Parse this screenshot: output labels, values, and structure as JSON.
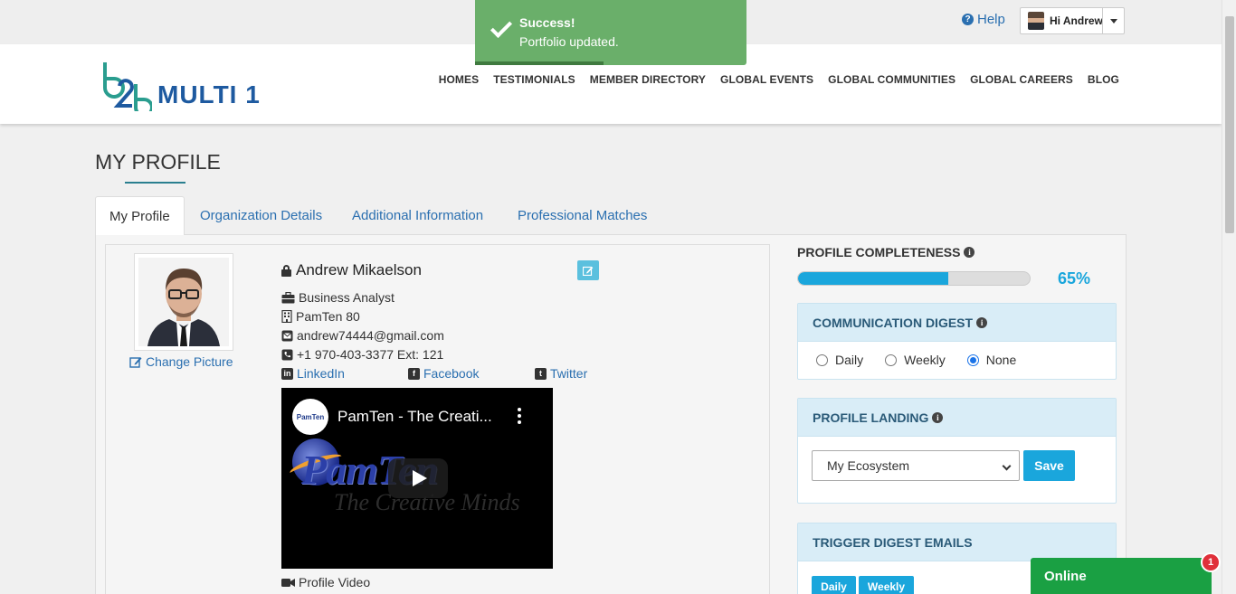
{
  "topbar": {
    "help_label": "Help",
    "user_greeting": "Hi Andrew"
  },
  "header": {
    "logo_mark": "b2b",
    "logo_text": "MULTI 1",
    "nav": [
      "HOMES",
      "TESTIMONIALS",
      "MEMBER DIRECTORY",
      "GLOBAL EVENTS",
      "GLOBAL COMMUNITIES",
      "GLOBAL CAREERS",
      "BLOG"
    ]
  },
  "toast": {
    "title": "Success!",
    "message": "Portfolio updated."
  },
  "page": {
    "title": "MY PROFILE",
    "tabs": [
      "My Profile",
      "Organization Details",
      "Additional Information",
      "Professional Matches"
    ],
    "active_tab": 0
  },
  "profile": {
    "change_picture": "Change Picture",
    "name": "Andrew Mikaelson",
    "title": "Business Analyst",
    "company": "PamTen 80",
    "email": "andrew74444@gmail.com",
    "phone": "+1 970-403-3377 Ext: 121",
    "linkedin": "LinkedIn",
    "facebook": "Facebook",
    "twitter": "Twitter",
    "video_title": "PamTen - The Creati...",
    "video_channel": "PamTen",
    "video_brand": "PamTen",
    "video_tagline": "The Creative Minds",
    "video_label": "Profile Video"
  },
  "completeness": {
    "label": "PROFILE COMPLETENESS",
    "percent": 65,
    "percent_label": "65%",
    "accent": "#1aa6dc"
  },
  "communication_digest": {
    "title": "COMMUNICATION DIGEST",
    "options": [
      "Daily",
      "Weekly",
      "None"
    ],
    "selected": "None"
  },
  "profile_landing": {
    "title": "PROFILE LANDING",
    "selected": "My Ecosystem",
    "save_label": "Save"
  },
  "trigger_digest": {
    "title": "TRIGGER DIGEST EMAILS",
    "buttons": [
      "Daily",
      "Weekly"
    ]
  },
  "chat": {
    "label": "Online",
    "badge": "1"
  }
}
